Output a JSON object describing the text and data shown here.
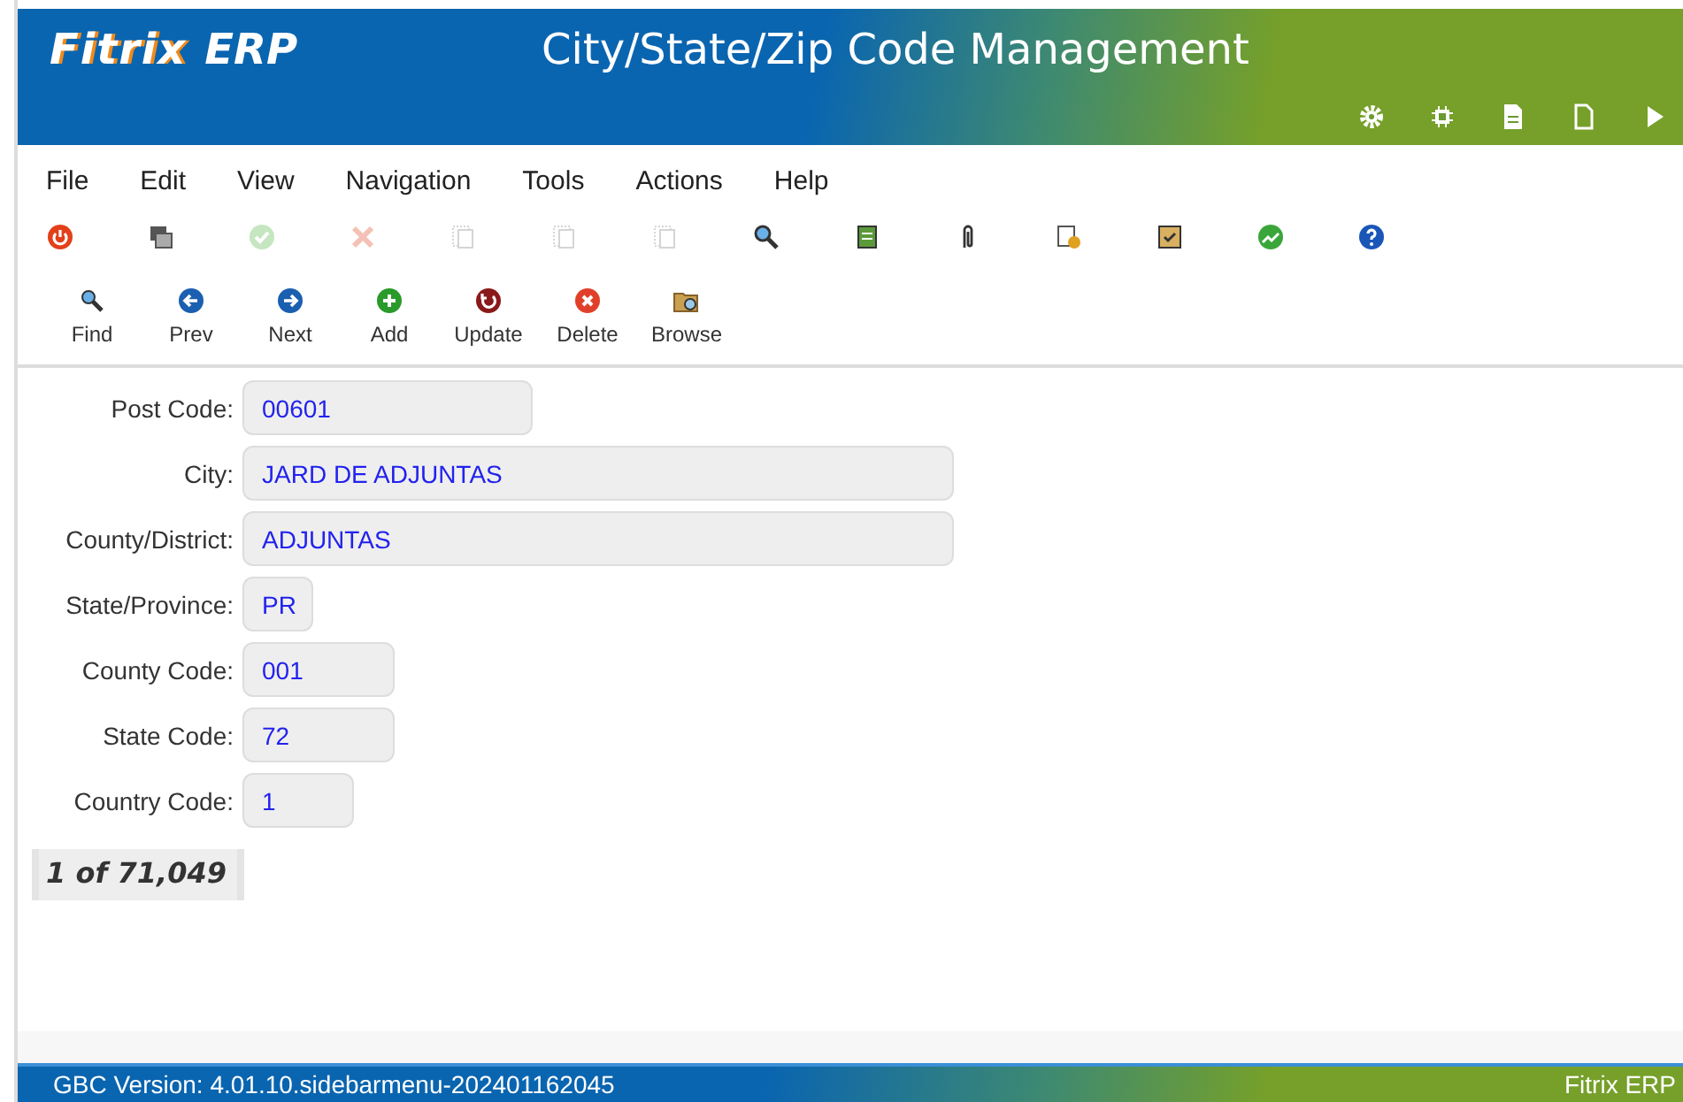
{
  "header": {
    "logo": "Fitrix",
    "logo_suffix": "ERP",
    "title": "City/State/Zip Code Management",
    "actions": [
      {
        "kind": "gear"
      },
      {
        "kind": "chip"
      },
      {
        "kind": "doc"
      },
      {
        "kind": "page"
      },
      {
        "kind": "play"
      }
    ]
  },
  "menu": [
    "File",
    "Edit",
    "View",
    "Navigation",
    "Tools",
    "Actions",
    "Help"
  ],
  "toolbar": [
    {
      "kind": "power",
      "disabled": false
    },
    {
      "kind": "windows",
      "disabled": false
    },
    {
      "kind": "check",
      "disabled": true
    },
    {
      "kind": "cross",
      "disabled": true
    },
    {
      "kind": "copy",
      "disabled": true
    },
    {
      "kind": "copy",
      "disabled": true
    },
    {
      "kind": "copy",
      "disabled": true
    },
    {
      "kind": "zoom",
      "disabled": false
    },
    {
      "kind": "notepad",
      "disabled": false
    },
    {
      "kind": "clip",
      "disabled": false
    },
    {
      "kind": "note",
      "disabled": false
    },
    {
      "kind": "checklist",
      "disabled": false
    },
    {
      "kind": "chart",
      "disabled": false
    },
    {
      "kind": "help",
      "disabled": false
    }
  ],
  "actions": [
    {
      "kind": "find",
      "label": "Find"
    },
    {
      "kind": "prev",
      "label": "Prev"
    },
    {
      "kind": "next",
      "label": "Next"
    },
    {
      "kind": "add",
      "label": "Add"
    },
    {
      "kind": "update",
      "label": "Update"
    },
    {
      "kind": "delete",
      "label": "Delete"
    },
    {
      "kind": "browse",
      "label": "Browse"
    }
  ],
  "fields": [
    {
      "label": "Post Code:",
      "value": "00601"
    },
    {
      "label": "City:",
      "value": "JARD DE ADJUNTAS"
    },
    {
      "label": "County/District:",
      "value": "ADJUNTAS"
    },
    {
      "label": "State/Province:",
      "value": "PR"
    },
    {
      "label": "County Code:",
      "value": "001"
    },
    {
      "label": "State Code:",
      "value": "72"
    },
    {
      "label": "Country Code:",
      "value": "1"
    }
  ],
  "record_count": "1 of 71,049",
  "status_bar": {
    "version": "GBC Version: 4.01.10.sidebarmenu-202401162045",
    "product": "Fitrix ERP"
  }
}
